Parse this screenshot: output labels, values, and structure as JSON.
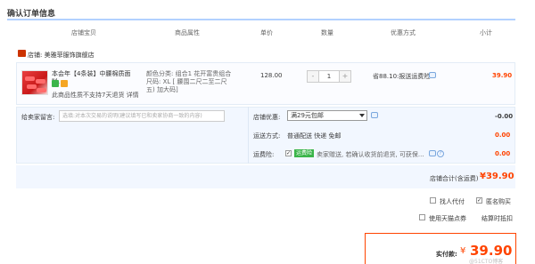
{
  "page": {
    "title": "确认订单信息"
  },
  "columns": [
    "店铺宝贝",
    "商品属性",
    "单价",
    "数量",
    "优惠方式",
    "小计"
  ],
  "shop": {
    "label": "店铺: 美雅菲服饰旗舰店"
  },
  "item": {
    "name": "本会年【4条装】中腰棉质面料...",
    "return_note": "此商品性质不支持7天退货 详情",
    "attr_line1": "颜色分类: 组合1 花开富贵组合",
    "attr_line2": "尺码: XL [ 腰围二尺二至二尺",
    "attr_line3": "五) 加大码]",
    "price": "128.00",
    "qty": "1",
    "qty_minus": "-",
    "qty_plus": "+",
    "promo": "省88.10:报送运费险",
    "subtotal": "39.90"
  },
  "message": {
    "label": "给卖家留言:",
    "placeholder": "选填:对本次交易的说明(建议填写已和卖家协商一致的内容)"
  },
  "shop_promo": {
    "label": "店铺优惠:",
    "selected": "满29元包邮",
    "amount": "-0.00"
  },
  "shipping": {
    "label": "运送方式:",
    "value": "普通配送 快递 免邮",
    "amount": "0.00"
  },
  "insurance": {
    "label": "运费险:",
    "tag": "运费险",
    "text": "卖家赠送, 若确认收货前退货, 可获保...",
    "amount": "0.00"
  },
  "store_total": {
    "label": "店铺合计(含运费)",
    "amount": "¥39.90"
  },
  "options": {
    "anonymous_pay": "找人代付",
    "anonymous_buy": "匿名购买",
    "tmall_points": "使用天猫点券",
    "points_deduct": "结算时抵扣"
  },
  "payment": {
    "label": "实付款:",
    "yen": "¥",
    "amount": "39.90"
  },
  "watermark": "@51CTO博客"
}
